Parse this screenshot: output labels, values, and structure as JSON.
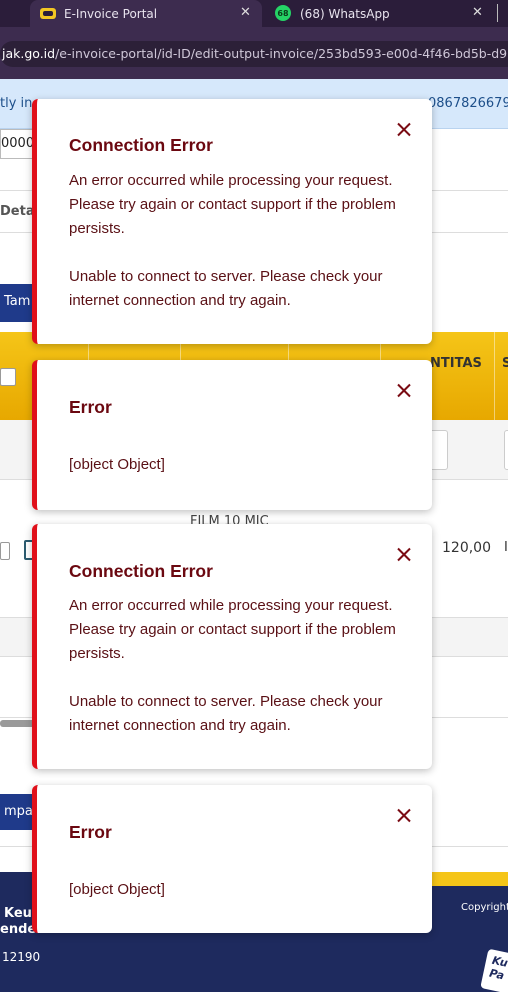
{
  "browser": {
    "tabs": [
      {
        "title": "E-Invoice Portal",
        "active": true
      },
      {
        "title": "(68) WhatsApp",
        "badge": "68",
        "active": false
      }
    ],
    "url": {
      "host": "jak.go.id",
      "path": "/e-invoice-portal/id-ID/edit-output-invoice/253bd593-e00d-4f46-bd5b-d9"
    }
  },
  "page": {
    "info_left": "tly in",
    "info_right": "0867826679",
    "field_value": "000000",
    "detail_tab": "Deta",
    "add_button": "Tam",
    "header_quantity": "NTITAS",
    "header_s": "S",
    "row": {
      "product": "FILM 10 MIC",
      "quantity": "120,00",
      "extra": "I"
    },
    "bottom_button": "mpan"
  },
  "footer": {
    "org_line1": "Keu",
    "org_line2": "ender",
    "postal": "12190",
    "copyright": "Copyright",
    "logo": "Ku Pa"
  },
  "toasts": [
    {
      "title": "Connection Error",
      "message_line1": "An error occurred while processing your request. Please try again or contact support if the problem persists.",
      "message_line2": "Unable to connect to server. Please check your internet connection and try again."
    },
    {
      "title": "Error",
      "message_line1": "[object Object]"
    },
    {
      "title": "Connection Error",
      "message_line1": "An error occurred while processing your request. Please try again or contact support if the problem persists.",
      "message_line2": "Unable to connect to server. Please check your internet connection and try again."
    },
    {
      "title": "Error",
      "message_line1": "[object Object]"
    }
  ],
  "colors": {
    "toast_accent": "#e0101a",
    "toast_text": "#6b0810",
    "header_yellow": "#f5c518",
    "footer_navy": "#1e2a5e"
  }
}
